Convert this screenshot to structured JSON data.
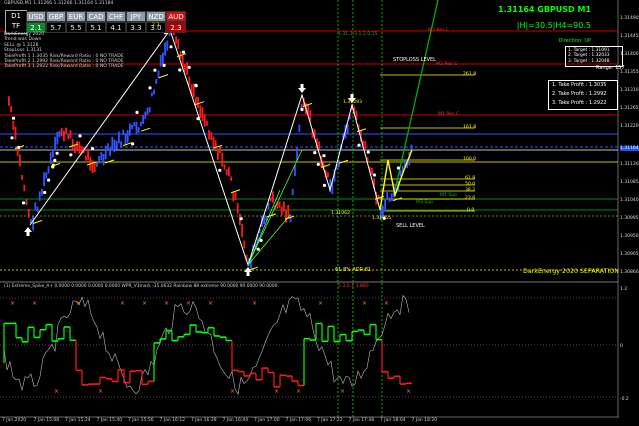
{
  "window": {
    "title_line": "GBPUSD,M1  1.31266 1.31266 1.31164 1.31184"
  },
  "timeframe": {
    "label": "D1",
    "sub": "TF"
  },
  "currency_table": {
    "headers": [
      "USD",
      "GBP",
      "EUR",
      "CAD",
      "CHF",
      "JPY",
      "NZD",
      "AUD"
    ],
    "values": [
      "2.1",
      "5.7",
      "5.5",
      "5.1",
      "4.1",
      "3.3",
      "3.0",
      "2.3"
    ]
  },
  "overlay_lines": [
    "DarkEnergy 2020",
    "Trend was Down",
    "SELL @ 1.3128",
    "StopLoss 1.3131",
    "TakeProfit 1 1.3035 Risk/Reward Ratio : 0 NO TRADE",
    "TakeProfit 2 1.2992 Risk/Reward Ratio : 0 NO TRADE",
    "TakeProfit 3 1.2922 Risk/Reward Ratio : 0 NO TRADE"
  ],
  "price_header": "1.31164 GBPUSD M1",
  "hl_header": "|H|=30.5|H4=90.5",
  "direction": "Direction: UP",
  "targets": [
    "1. Target : 1.31091",
    "2. Target : 1.32033",
    "3. Target : 1.32048"
  ],
  "range": "Range: 157",
  "take_profits": [
    "1. Take Profit : 1.3035",
    "2. Take Profit : 1.2992",
    "3. Take Profit : 1.2922"
  ],
  "labels": {
    "stoploss_level": "STOPLOSS LEVEL",
    "sell_level": "SELL LEVEL",
    "m3_res": "M3 Res C",
    "m2_res": "M2 Res C",
    "m1_res": "M1 Res C",
    "m1_sup": "M1 Sup",
    "m3_sup": "M3 Sup",
    "fib_261": "261.8",
    "fib_161": "161.8",
    "fib_100": "100.0",
    "fib_618": "61.8",
    "fib_500": "50.0",
    "fib_382": "38.2",
    "fib_236": "23.6",
    "fib_0": "0.0",
    "adr": "61.8% ADR:81",
    "pivot_top": "1.31293",
    "pivot_bot": "1.31062",
    "pivot_bot2": "1.31055",
    "pivot_mid": "2.3",
    "red_low": "2.3.0.1.3.880",
    "green_top": "1.31.1.3.1.3.0.15"
  },
  "signature": "DarkEnergy 2020 SEPARATION",
  "indicator_label": "(1) Extreme_Spike_A+ 0.0000 0.0000 0.0000 0.0000 WPR_V3mark -35.0632  Rainbow 88 extreme 90.0000 90.0000 90.0000",
  "price_axis": [
    "1.31490",
    "1.31445",
    "1.31400",
    "1.31355",
    "1.31310",
    "1.31265",
    "1.31220",
    "1.31164",
    "1.31130",
    "1.31085",
    "1.31040",
    "1.30995",
    "1.30950",
    "1.30905",
    "1.30860"
  ],
  "ind_axis": [
    "1.2",
    "0",
    "-0.2"
  ],
  "time_axis": [
    "7 Jan 2020",
    "7 Jan 15:08",
    "7 Jan 15:24",
    "7 Jan 15:40",
    "7 Jan 15:56",
    "7 Jan 16:12",
    "7 Jan 16:28",
    "7 Jan 16:44",
    "7 Jan 17:00",
    "7 Jan 17:06",
    "7 Jan 17:22",
    "7 Jan 17:48",
    "7 Jan 18:04",
    "7 Jan 18:20"
  ],
  "colors": {
    "bull": "#3355ff",
    "bear": "#ff1a1a",
    "zigzag": "#ffffff",
    "accent": "#00ff00",
    "level_red": "#cc0000",
    "level_yellow": "#ffff00",
    "level_green": "#00c000",
    "level_blue": "#3355ff"
  },
  "icons": [
    "up-arrow-icon",
    "down-arrow-icon",
    "trade-icon"
  ]
}
